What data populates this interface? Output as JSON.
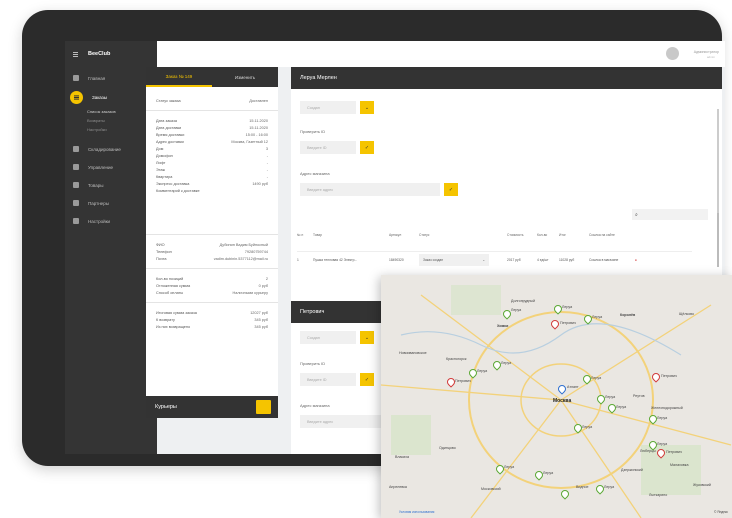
{
  "sidebar": {
    "logo": "BeeClub",
    "items": [
      {
        "label": "Главная",
        "icon": "home-icon"
      },
      {
        "label": "Заказы",
        "icon": "orders-icon",
        "active": true
      },
      {
        "label": "Складирование",
        "icon": "storage-icon"
      },
      {
        "label": "Управление",
        "icon": "manage-icon"
      },
      {
        "label": "Товары",
        "icon": "goods-icon"
      },
      {
        "label": "Партнеры",
        "icon": "partners-icon"
      },
      {
        "label": "Настройки",
        "icon": "settings-icon"
      }
    ],
    "subitems": [
      {
        "label": "Список заказов"
      },
      {
        "label": "Возвраты"
      },
      {
        "label": "Настройки"
      }
    ]
  },
  "topbar": {
    "user_name": "Администратор",
    "user_sub": "admin"
  },
  "order": {
    "tabs": [
      "Заказ № 149",
      "Изменить"
    ],
    "status_label": "Статус заказа",
    "status_value": "Доставлен",
    "details": [
      {
        "k": "Дата заказа",
        "v": "15.11.2020"
      },
      {
        "k": "Дата доставки",
        "v": "15.11.2020"
      },
      {
        "k": "Время доставки",
        "v": "15:00 - 16:00"
      },
      {
        "k": "Адрес доставки",
        "v": "Москва, Газетный 12"
      },
      {
        "k": "Дом",
        "v": "3"
      },
      {
        "k": "Домофон",
        "v": "-"
      },
      {
        "k": "Лифт",
        "v": "-"
      },
      {
        "k": "Этаж",
        "v": "-"
      },
      {
        "k": "Квартира",
        "v": "-"
      },
      {
        "k": "Экспресс доставка",
        "v": "1490 руб"
      },
      {
        "k": "Комментарий к доставке",
        "v": ""
      }
    ],
    "contacts": [
      {
        "k": "ФИО",
        "v": "Дубинин Вадим Буйносный"
      },
      {
        "k": "Телефон",
        "v": "79280759744"
      },
      {
        "k": "Почта",
        "v": "vadim.dubinin.5377112@mail.ru"
      }
    ],
    "payment": [
      {
        "k": "Кол-во позиций",
        "v": "2"
      },
      {
        "k": "Отложенная сумма",
        "v": "0 руб"
      },
      {
        "k": "Способ оплаты",
        "v": "Наличными курьеру"
      }
    ],
    "totals": [
      {
        "k": "Итоговая сумма заказа",
        "v": "12027 руб"
      },
      {
        "k": "К возврату",
        "v": "345 руб"
      },
      {
        "k": "Из них возвращено",
        "v": "345 руб"
      }
    ],
    "couriers_label": "Курьеры"
  },
  "store": {
    "title": "Леруа Мерлен",
    "status_placeholder": "Создан",
    "project_id_label": "Проверить ID",
    "project_id_placeholder": "Введите ID",
    "address_label": "Адрес магазина",
    "address_placeholder": "Введите адрес",
    "search_icon": "search-icon",
    "columns": [
      "№ п",
      "Товар",
      "Артикул",
      "Статус",
      "Стоимость",
      "Кол-во",
      "Итог",
      "Ссылка на сайте"
    ],
    "rows": [
      {
        "n": "1",
        "product": "Пушка тепловая 42 Электр...",
        "sku": "18490320",
        "status": "Заказ создан",
        "price": "2017 руб",
        "qty": "4 ед/шт",
        "total": "11028 руб",
        "link": "Ссылка в магазине"
      }
    ]
  },
  "petrovich": {
    "title": "Петрович",
    "status_placeholder": "Создан",
    "project_id_label": "Проверить ID",
    "project_id_placeholder": "Введите ID",
    "address_label": "Адрес магазина",
    "address_placeholder": "Введите адрес"
  },
  "map": {
    "city": "Москва",
    "labels": [
      {
        "t": "Долгопрудный"
      },
      {
        "t": "Химки"
      },
      {
        "t": "Королёв"
      },
      {
        "t": "Щёлково"
      },
      {
        "t": "Красногорск"
      },
      {
        "t": "Реутов"
      },
      {
        "t": "Железнодорожный"
      },
      {
        "t": "Одинцово"
      },
      {
        "t": "Люберцы"
      },
      {
        "t": "Малаховка"
      },
      {
        "t": "Дзержинский"
      },
      {
        "t": "Жуковский"
      },
      {
        "t": "Лыткарино"
      },
      {
        "t": "Видное"
      },
      {
        "t": "Московский"
      },
      {
        "t": "Новоивановское"
      },
      {
        "t": "Власиха"
      },
      {
        "t": "Апрелевка"
      }
    ],
    "pin_names": [
      "Леруа",
      "Петрович",
      "Атлант"
    ],
    "footer_link": "Условия использования",
    "footer_brand": "© Яндекс"
  }
}
